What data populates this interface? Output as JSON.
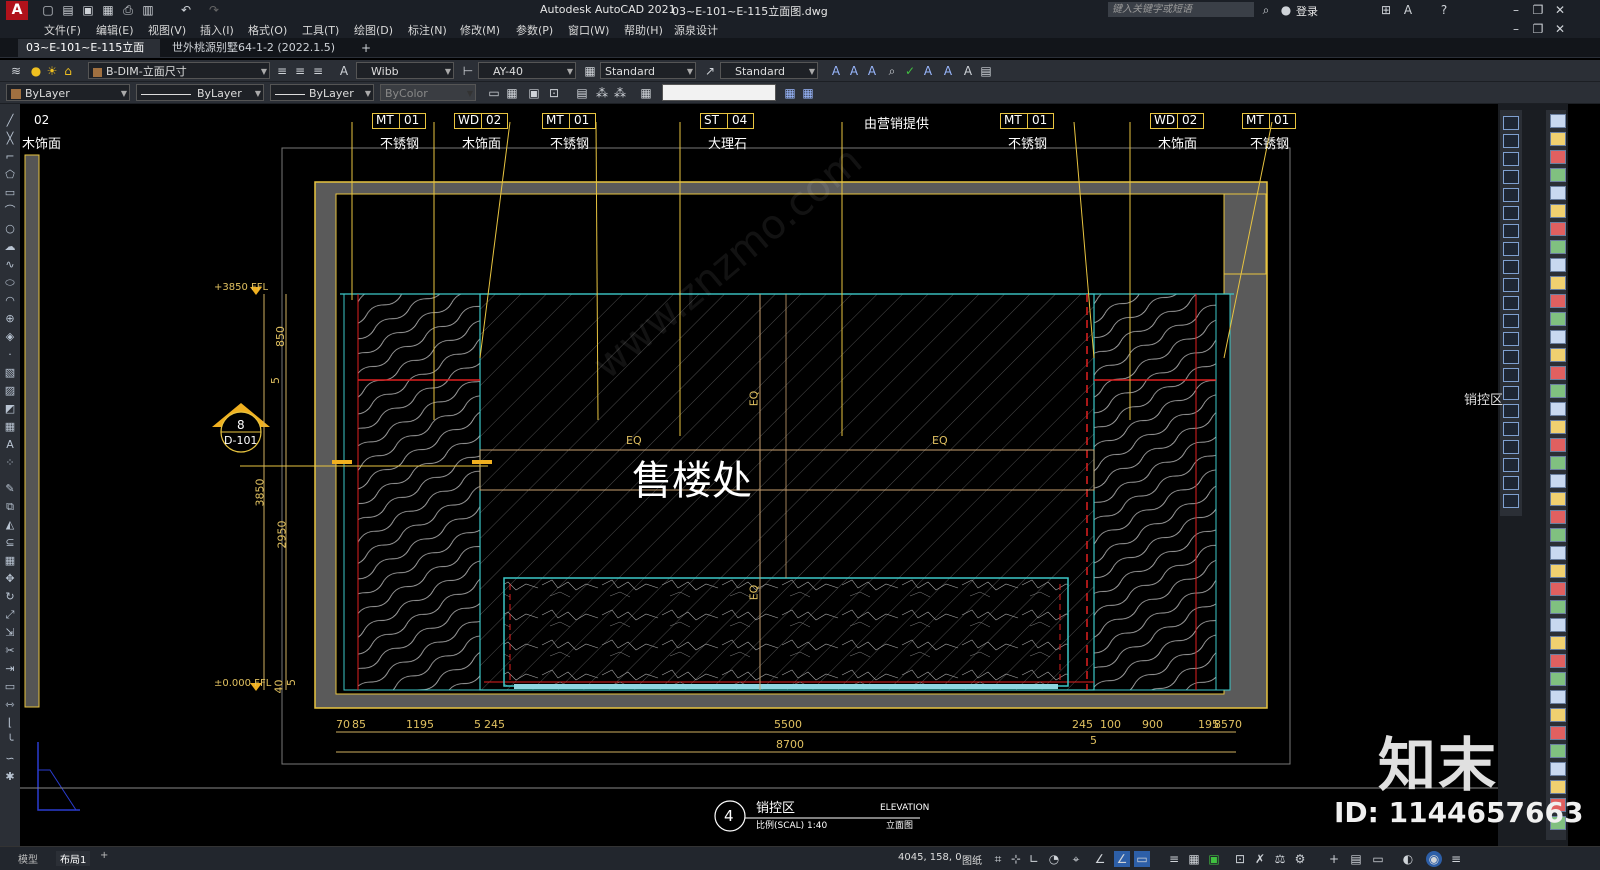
{
  "titlebar": {
    "app_title": "Autodesk AutoCAD 2021",
    "doc_title": "03~E-101~E-115立面图.dwg",
    "search_placeholder": "键入关键字或短语",
    "login": "登录"
  },
  "menu": [
    "文件(F)",
    "编辑(E)",
    "视图(V)",
    "插入(I)",
    "格式(O)",
    "工具(T)",
    "绘图(D)",
    "标注(N)",
    "修改(M)",
    "参数(P)",
    "窗口(W)",
    "帮助(H)",
    "源泉设计"
  ],
  "tabs": [
    {
      "label": "03~E-101~E-115立面图*",
      "active": true
    },
    {
      "label": "世外桃源别墅64-1-2 (2022.1.5) *",
      "active": false
    }
  ],
  "properties": {
    "layer": "B-DIM-立面尺寸",
    "text_style": "Wibb",
    "dim_style": "AY-40",
    "table_style": "Standard",
    "multileader_style": "Standard",
    "color": "ByLayer",
    "linetype": "ByLayer",
    "lineweight": "ByLayer",
    "plot_style": "ByColor"
  },
  "drawing": {
    "callouts": [
      {
        "code": "MT",
        "num": "01",
        "label": "不锈钢"
      },
      {
        "code": "WD",
        "num": "02",
        "label": "木饰面"
      },
      {
        "code": "MT",
        "num": "01",
        "label": "不锈钢"
      },
      {
        "code": "ST",
        "num": "04",
        "label": "大理石"
      },
      {
        "code": "",
        "num": "",
        "label": "由营销提供"
      },
      {
        "code": "MT",
        "num": "01",
        "label": "不锈钢"
      },
      {
        "code": "WD",
        "num": "02",
        "label": "木饰面"
      },
      {
        "code": "MT",
        "num": "01",
        "label": "不锈钢"
      }
    ],
    "left_partial_callout": {
      "num": "02",
      "label": "木饰面"
    },
    "main_label": "售楼处",
    "eq_labels": [
      "EQ",
      "EQ",
      "EQ",
      "EQ"
    ],
    "level_top": "+3850 FFL",
    "level_bottom": "±0.000 FFL",
    "vertical_dims": [
      "850",
      "5",
      "3850",
      "2950",
      "40",
      "5"
    ],
    "horizontal_dims": [
      "70",
      "85",
      "1195",
      "5",
      "245",
      "5500",
      "245",
      "100",
      "900",
      "195",
      "85",
      "70"
    ],
    "total_dim": "8700",
    "sub_dim": "5",
    "section_marker": {
      "number": "8",
      "sheet": "D-101"
    },
    "title_block": {
      "number": "4",
      "name": "销控区",
      "scale": "比例(SCAL) 1:40",
      "elevation_en": "ELEVATION",
      "elevation_cn": "立面图"
    },
    "side_label": "销控区"
  },
  "watermark": {
    "brand": "知末",
    "id": "ID: 1144657663",
    "site": "www.znzmo.com"
  },
  "statusbar": {
    "tabs": [
      "模型",
      "布局1"
    ],
    "coords": "4045, 158, 0",
    "mode": "图纸"
  }
}
